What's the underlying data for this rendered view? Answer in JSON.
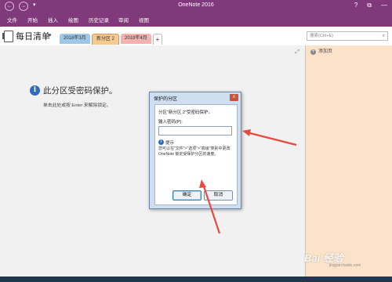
{
  "window": {
    "title": "OneNote 2016"
  },
  "qat": {
    "back": "←",
    "forward": "→",
    "more": "▾"
  },
  "window_controls": {
    "help": "?",
    "restore": "⧉",
    "minimize": "—"
  },
  "ribbon_tabs": [
    "文件",
    "开始",
    "插入",
    "绘图",
    "历史记录",
    "审阅",
    "视图"
  ],
  "notebook": {
    "name": "每日清单",
    "dropdown": "▾"
  },
  "sections": [
    "2018年3月",
    "新分区 2",
    "2018年4月",
    "+"
  ],
  "search": {
    "placeholder": "搜索(Ctrl+E)",
    "icon": "search-icon"
  },
  "locked": {
    "title": "此分区受密码保护。",
    "hint": "单击此处或按 Enter 来解除锁定。"
  },
  "page_panel": {
    "add_page": "添加页"
  },
  "dialog": {
    "title": "保护的分区",
    "close": "x",
    "message": "分区\"新分区 2\"受密码保护。",
    "password_label": "输入密码(P):",
    "password_value": "",
    "tip_heading": "提示",
    "tip_body": "您可以在\"文件\">\"选项\">\"高级\"类别中更改 OneNote 锁定受保护分区的速度。",
    "ok": "确定",
    "cancel": "取消"
  },
  "watermark": {
    "brand": "Bai 经验",
    "sub": "jingyan.baidu.com"
  },
  "colors": {
    "titlebar": "#80397b",
    "accent_arrow": "#e84a3f",
    "page_panel": "#fbe3c9"
  }
}
